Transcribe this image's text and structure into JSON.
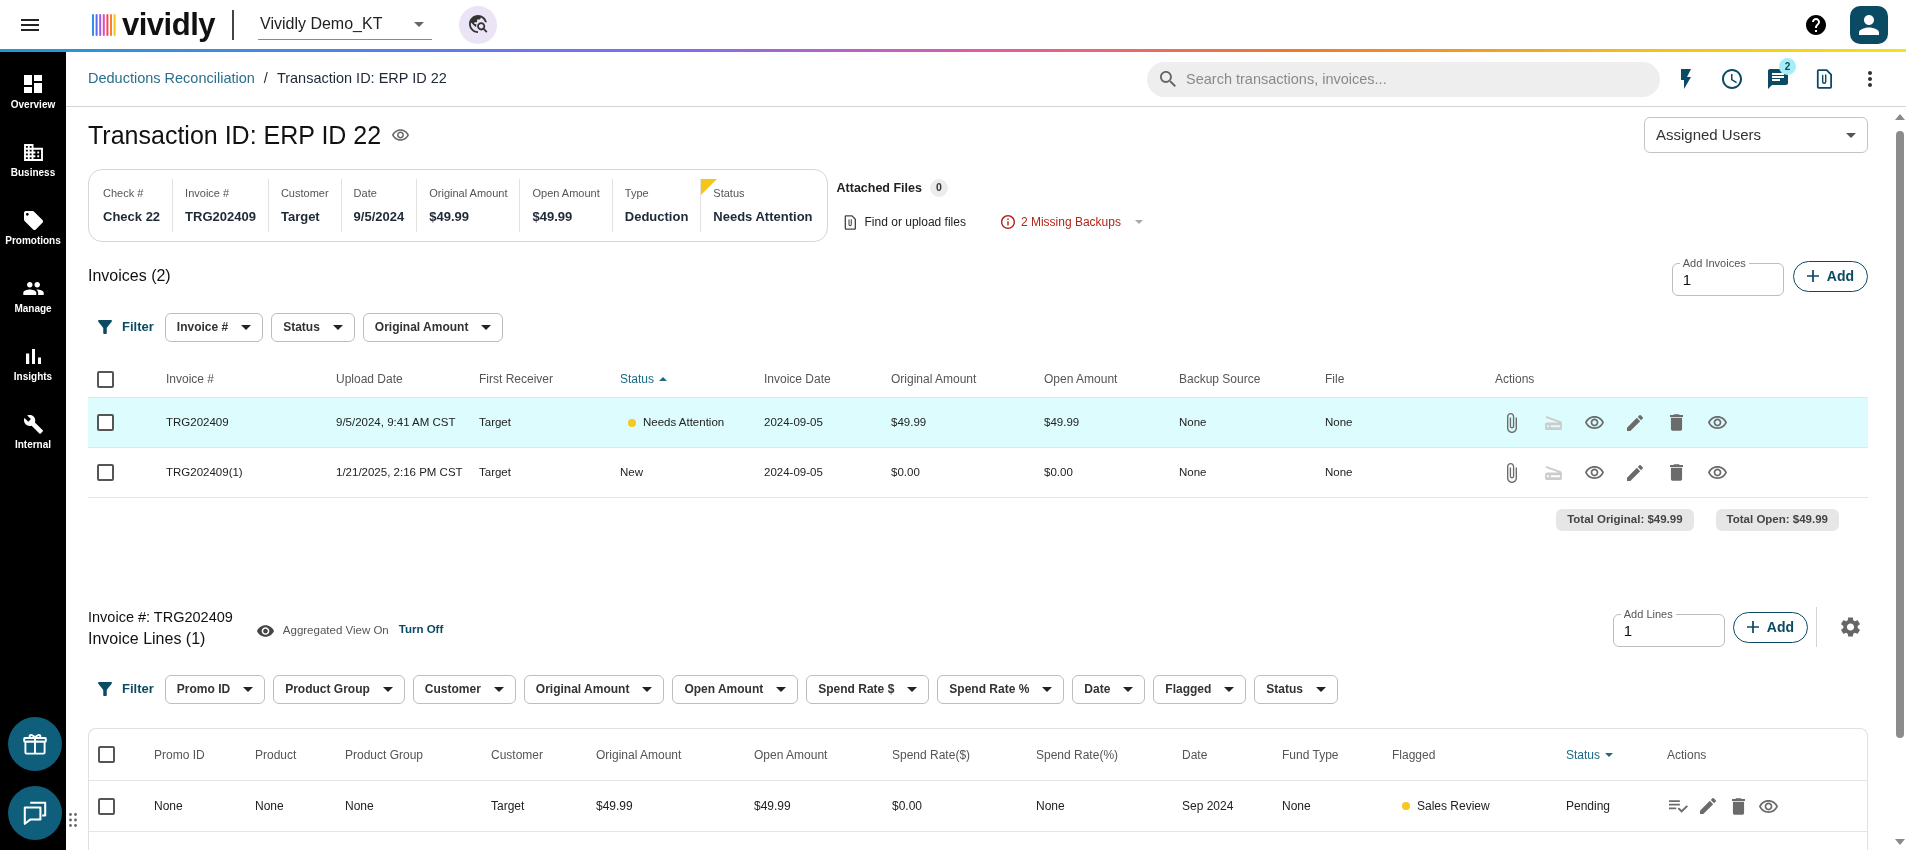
{
  "header": {
    "logo_text": "vividly",
    "workspace": "Vividly Demo_KT"
  },
  "sidebar": {
    "items": [
      {
        "label": "Overview"
      },
      {
        "label": "Business"
      },
      {
        "label": "Promotions"
      },
      {
        "label": "Manage"
      },
      {
        "label": "Insights"
      },
      {
        "label": "Internal"
      }
    ]
  },
  "breadcrumb": {
    "items": [
      {
        "label": "Deductions Reconciliation",
        "current": false
      },
      {
        "label": "Transaction ID: ERP ID 22",
        "current": true
      }
    ],
    "separator": "/"
  },
  "search": {
    "placeholder": "Search transactions, invoices..."
  },
  "toolbar": {
    "message_badge": "2"
  },
  "title": "Transaction ID: ERP ID 22",
  "assigned_users": {
    "label": "Assigned Users"
  },
  "summary": [
    {
      "label": "Check #",
      "value": "Check 22",
      "flagged": false
    },
    {
      "label": "Invoice #",
      "value": "TRG202409",
      "flagged": false
    },
    {
      "label": "Customer",
      "value": "Target",
      "flagged": false
    },
    {
      "label": "Date",
      "value": "9/5/2024",
      "flagged": false
    },
    {
      "label": "Original Amount",
      "value": "$49.99",
      "flagged": false
    },
    {
      "label": "Open Amount",
      "value": "$49.99",
      "flagged": false
    },
    {
      "label": "Type",
      "value": "Deduction",
      "flagged": false
    },
    {
      "label": "Status",
      "value": "Needs Attention",
      "flagged": true
    }
  ],
  "attached_files": {
    "label": "Attached Files",
    "count": "0",
    "upload": "Find or upload files",
    "missing_backups": "2 Missing Backups"
  },
  "invoices": {
    "title": "Invoices (2)",
    "add_field": {
      "label": "Add Invoices",
      "value": "1"
    },
    "add_button": "Add",
    "filter_label": "Filter",
    "filters": [
      "Invoice #",
      "Status",
      "Original Amount"
    ],
    "select_all": {
      "checked": false
    },
    "columns": [
      {
        "label": "Invoice #"
      },
      {
        "label": "Upload Date"
      },
      {
        "label": "First Receiver"
      },
      {
        "label": "Status",
        "sort_asc": true
      },
      {
        "label": "Invoice Date"
      },
      {
        "label": "Original Amount"
      },
      {
        "label": "Open Amount"
      },
      {
        "label": "Backup Source"
      },
      {
        "label": "File"
      },
      {
        "label": "Actions"
      }
    ],
    "rows": [
      {
        "selected": true,
        "checked": false,
        "cells": [
          "TRG202409",
          "9/5/2024, 9:41 AM CST",
          "Target",
          {
            "text": "Needs Attention",
            "color": "#f9c623"
          },
          "2024-09-05",
          "$49.99",
          "$49.99",
          "None",
          "None"
        ],
        "actions": [
          {
            "kind": "attach",
            "disabled": false
          },
          {
            "kind": "scan",
            "disabled": true
          },
          {
            "kind": "view",
            "disabled": false
          },
          {
            "kind": "edit",
            "disabled": false
          },
          {
            "kind": "delete",
            "disabled": false
          },
          {
            "kind": "preview",
            "disabled": false
          }
        ]
      },
      {
        "selected": false,
        "checked": false,
        "cells": [
          "TRG202409(1)",
          "1/21/2025, 2:16 PM CST",
          "Target",
          "New",
          "2024-09-05",
          "$0.00",
          "$0.00",
          "None",
          "None"
        ],
        "actions": [
          {
            "kind": "attach",
            "disabled": false
          },
          {
            "kind": "scan",
            "disabled": true
          },
          {
            "kind": "view",
            "disabled": false
          },
          {
            "kind": "edit",
            "disabled": false
          },
          {
            "kind": "delete",
            "disabled": false
          },
          {
            "kind": "preview",
            "disabled": false
          }
        ]
      }
    ],
    "totals": [
      "Total Original: $49.99",
      "Total Open: $49.99"
    ]
  },
  "invoice_lines": {
    "invoice_label": "Invoice #: TRG202409",
    "title": "Invoice Lines (1)",
    "aggregated": {
      "label": "Aggregated View On",
      "action": "Turn Off"
    },
    "add_field": {
      "label": "Add Lines",
      "value": "1"
    },
    "add_button": "Add",
    "filter_label": "Filter",
    "filters": [
      "Promo ID",
      "Product Group",
      "Customer",
      "Original Amount",
      "Open Amount",
      "Spend Rate $",
      "Spend Rate %",
      "Date",
      "Flagged",
      "Status"
    ],
    "select_all": {
      "checked": false
    },
    "columns": [
      {
        "label": "Promo ID"
      },
      {
        "label": "Product"
      },
      {
        "label": "Product Group"
      },
      {
        "label": "Customer"
      },
      {
        "label": "Original Amount"
      },
      {
        "label": "Open Amount"
      },
      {
        "label": "Spend Rate($)"
      },
      {
        "label": "Spend Rate(%)"
      },
      {
        "label": "Date"
      },
      {
        "label": "Fund Type"
      },
      {
        "label": "Flagged"
      },
      {
        "label": "Status",
        "sort_desc": true
      },
      {
        "label": "Actions"
      }
    ],
    "rows": [
      {
        "checked": false,
        "cells": [
          "None",
          "None",
          "None",
          "Target",
          "$49.99",
          "$49.99",
          "$0.00",
          "None",
          "Sep 2024",
          "None",
          {
            "text": "Sales Review",
            "color": "#f9c623"
          },
          "Pending"
        ],
        "actions": [
          {
            "kind": "lines"
          },
          {
            "kind": "edit"
          },
          {
            "kind": "delete"
          },
          {
            "kind": "view"
          }
        ]
      }
    ]
  }
}
